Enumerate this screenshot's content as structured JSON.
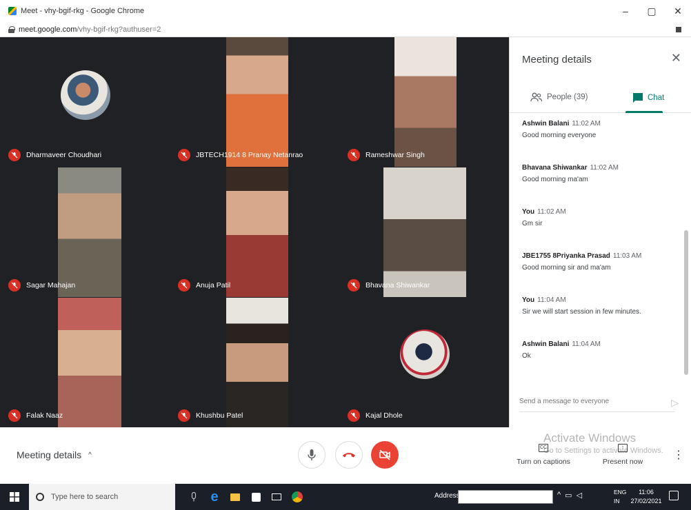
{
  "browser": {
    "window_title": "Meet - vhy-bgif-rkg - Google Chrome",
    "url_host": "meet.google.com",
    "url_path": "/vhy-bgif-rkg?authuser=2",
    "controls": {
      "minimize": "–",
      "maximize": "▢",
      "close": "✕"
    }
  },
  "participants": [
    {
      "name": "Dharmaveer Choudhari",
      "type": "avatar",
      "color": "#8a9aa8"
    },
    {
      "name": "JBTECH1914 8 Pranay Netanrao",
      "type": "video",
      "color": "#c8734c"
    },
    {
      "name": "Rameshwar Singh",
      "type": "video",
      "color": "#b8a894"
    },
    {
      "name": "Sagar Mahajan",
      "type": "video",
      "color": "#8a7d6a"
    },
    {
      "name": "Anuja Patil",
      "type": "video",
      "color": "#9a5a50"
    },
    {
      "name": "Bhavana Shiwankar",
      "type": "video",
      "color": "#c9c4bc"
    },
    {
      "name": "Falak Naaz",
      "type": "video",
      "color": "#a86458"
    },
    {
      "name": "Khushbu Patel",
      "type": "video",
      "color": "#b89a88"
    },
    {
      "name": "Kajal Dhole",
      "type": "avatar",
      "color": "#b0aaa4"
    }
  ],
  "panel": {
    "title": "Meeting details",
    "close": "✕",
    "tab_people": "People (39)",
    "tab_chat": "Chat",
    "compose_placeholder": "Send a message to everyone",
    "send": "▷",
    "messages": [
      {
        "sender": "Ashwin Balani",
        "time": "11:02 AM",
        "text": "Good morning everyone"
      },
      {
        "sender": "Bhavana Shiwankar",
        "time": "11:02 AM",
        "text": "Good morning ma'am"
      },
      {
        "sender": "You",
        "time": "11:02 AM",
        "text": "Gm sir"
      },
      {
        "sender": "JBE1755 8Priyanka Prasad",
        "time": "11:03 AM",
        "text": "Good morning sir and ma'am"
      },
      {
        "sender": "You",
        "time": "11:04 AM",
        "text": "Sir we will start session in few minutes."
      },
      {
        "sender": "Ashwin Balani",
        "time": "11:04 AM",
        "text": "Ok"
      }
    ]
  },
  "controls": {
    "meeting_details": "Meeting details",
    "chevron": "^",
    "captions_label": "Turn on captions",
    "captions_icon": "CC",
    "present_label": "Present now",
    "present_icon": "↑",
    "more": "⋮",
    "watermark_line1": "Activate Windows",
    "watermark_line2": "Go to Settings to activate Windows."
  },
  "taskbar": {
    "search_placeholder": "Type here to search",
    "address_label": "Address",
    "lang_line1": "ENG",
    "lang_line2": "IN",
    "time": "11:06",
    "date": "27/02/2021",
    "apps": [
      "ie-icon",
      "file-explorer-icon",
      "store-icon",
      "mail-icon",
      "chrome-icon"
    ]
  },
  "colors": {
    "meet_dark": "#202124",
    "mute_red": "#d93025",
    "chat_green": "#00796b",
    "cam_off_red": "#ea4335"
  }
}
